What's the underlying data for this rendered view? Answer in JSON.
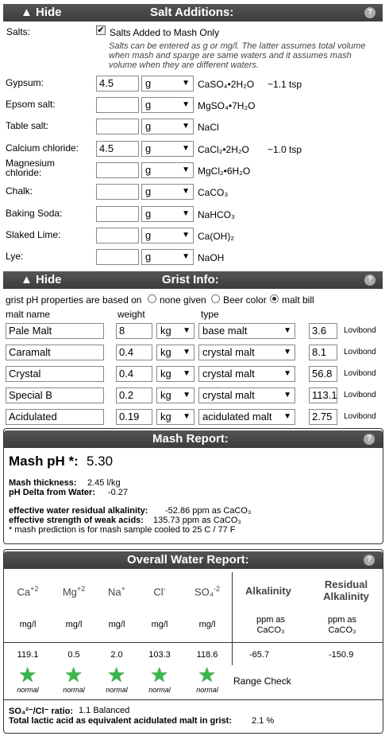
{
  "salt_section": {
    "hide_label": "▲ Hide",
    "title": "Salt Additions:",
    "help": "?",
    "salts_label": "Salts:",
    "checkbox_label": "Salts Added to Mash Only",
    "checked": true,
    "note": "Salts can be entered as g or mg/l. The latter assumes total volume when mash and sparge are same waters and it assumes mash volume when they are different waters.",
    "rows": [
      {
        "label": "Gypsum:",
        "value": "4.5",
        "unit": "g",
        "formula": "CaSO₄•2H₂O",
        "tsp": "~1.1 tsp"
      },
      {
        "label": "Epsom salt:",
        "value": "",
        "unit": "g",
        "formula": "MgSO₄•7H₂O",
        "tsp": ""
      },
      {
        "label": "Table salt:",
        "value": "",
        "unit": "g",
        "formula": "NaCl",
        "tsp": ""
      },
      {
        "label": "Calcium chloride:",
        "value": "4.5",
        "unit": "g",
        "formula": "CaCl₂•2H₂O",
        "tsp": "~1.0 tsp"
      },
      {
        "label": "Magnesium chloride:",
        "value": "",
        "unit": "g",
        "formula": "MgCl₂•6H₂O",
        "tsp": ""
      },
      {
        "label": "Chalk:",
        "value": "",
        "unit": "g",
        "formula": "CaCO₃",
        "tsp": ""
      },
      {
        "label": "Baking Soda:",
        "value": "",
        "unit": "g",
        "formula": "NaHCO₃",
        "tsp": ""
      },
      {
        "label": "Slaked Lime:",
        "value": "",
        "unit": "g",
        "formula": "Ca(OH)₂",
        "tsp": ""
      },
      {
        "label": "Lye:",
        "value": "",
        "unit": "g",
        "formula": "NaOH",
        "tsp": ""
      }
    ]
  },
  "grist_section": {
    "hide_label": "▲ Hide",
    "title": "Grist Info:",
    "help": "?",
    "ph_label": "grist pH properties are based on",
    "options": [
      "none given",
      "Beer color",
      "malt bill"
    ],
    "selected": "malt bill",
    "col_malt": "malt name",
    "col_weight": "weight",
    "col_type": "type",
    "rows": [
      {
        "name": "Pale Malt",
        "weight": "8",
        "unit": "kg",
        "type": "base malt",
        "color": "3.6",
        "color_unit": "Lovibond"
      },
      {
        "name": "Caramalt",
        "weight": "0.4",
        "unit": "kg",
        "type": "crystal malt",
        "color": "8.1",
        "color_unit": "Lovibond"
      },
      {
        "name": "Crystal",
        "weight": "0.4",
        "unit": "kg",
        "type": "crystal malt",
        "color": "56.8",
        "color_unit": "Lovibond"
      },
      {
        "name": "Special B",
        "weight": "0.2",
        "unit": "kg",
        "type": "crystal malt",
        "color": "113.1",
        "color_unit": "Lovibond"
      },
      {
        "name": "Acidulated",
        "weight": "0.19",
        "unit": "kg",
        "type": "acidulated malt",
        "color": "2.75",
        "color_unit": "Lovibond"
      }
    ]
  },
  "mash_report": {
    "title": "Mash Report:",
    "help": "?",
    "ph_label": "Mash pH *:",
    "ph_value": "5.30",
    "thickness_label": "Mash thickness:",
    "thickness_value": "2.45 l/kg",
    "delta_label": "pH Delta from Water:",
    "delta_value": "-0.27",
    "ra_label": "effective water residual alkalinity:",
    "ra_value": "-52.86 ppm as CaCO₃",
    "wa_label": "effective strength of weak acids:",
    "wa_value": "135.73 ppm as CaCO₃",
    "footnote": "* mash prediction is for mash sample cooled to 25 C / 77 F"
  },
  "water_report": {
    "title": "Overall Water Report:",
    "help": "?",
    "ions": [
      {
        "name": "Ca",
        "charge": "+2",
        "unit": "mg/l",
        "value": "119.1",
        "status": "normal"
      },
      {
        "name": "Mg",
        "charge": "+2",
        "unit": "mg/l",
        "value": "0.5",
        "status": "normal"
      },
      {
        "name": "Na",
        "charge": "+",
        "unit": "mg/l",
        "value": "2.0",
        "status": "normal"
      },
      {
        "name": "Cl",
        "charge": "-",
        "unit": "mg/l",
        "value": "103.3",
        "status": "normal"
      },
      {
        "name": "SO₄",
        "charge": "-2",
        "unit": "mg/l",
        "value": "118.6",
        "status": "normal"
      }
    ],
    "alk_label": "Alkalinity",
    "alk_unit": "ppm as CaCO₃",
    "alk_value": "-65.7",
    "ralk_label": "Residual Alkalinity",
    "ralk_unit": "ppm as CaCO₃",
    "ralk_value": "-150.9",
    "range_check": "Range Check",
    "ratio_label": "SO₄²⁻/Cl⁻ ratio:",
    "ratio_value": "1.1 Balanced",
    "lactic_label": "Total lactic acid as equivalent acidulated malt in grist:",
    "lactic_value": "2.1 %"
  },
  "colors": {
    "header": "#444444",
    "star": "#3bb54a"
  }
}
